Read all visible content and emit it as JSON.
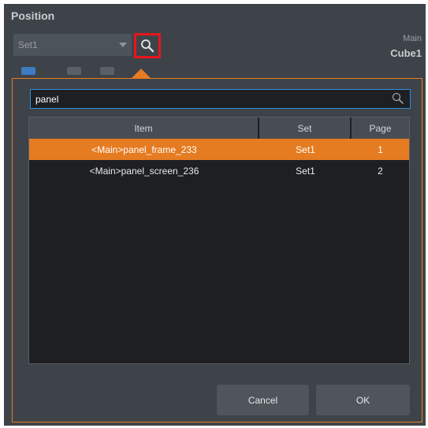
{
  "panel": {
    "title": "Position",
    "set_select_value": "Set1",
    "main_label": "Main",
    "object_label": "Cube1"
  },
  "colors": {
    "accent": "#e57c22",
    "highlight_box": "#e8151b",
    "search_focus": "#2f8fe0"
  },
  "icons": {
    "search_button": "search-icon",
    "search_field": "search-icon"
  },
  "dialog": {
    "search_value": "panel",
    "columns": [
      "Item",
      "Set",
      "Page"
    ],
    "rows": [
      {
        "item": "<Main>panel_frame_233",
        "set": "Set1",
        "page": "1",
        "selected": true
      },
      {
        "item": "<Main>panel_screen_236",
        "set": "Set1",
        "page": "2",
        "selected": false
      }
    ],
    "cancel_label": "Cancel",
    "ok_label": "OK"
  }
}
